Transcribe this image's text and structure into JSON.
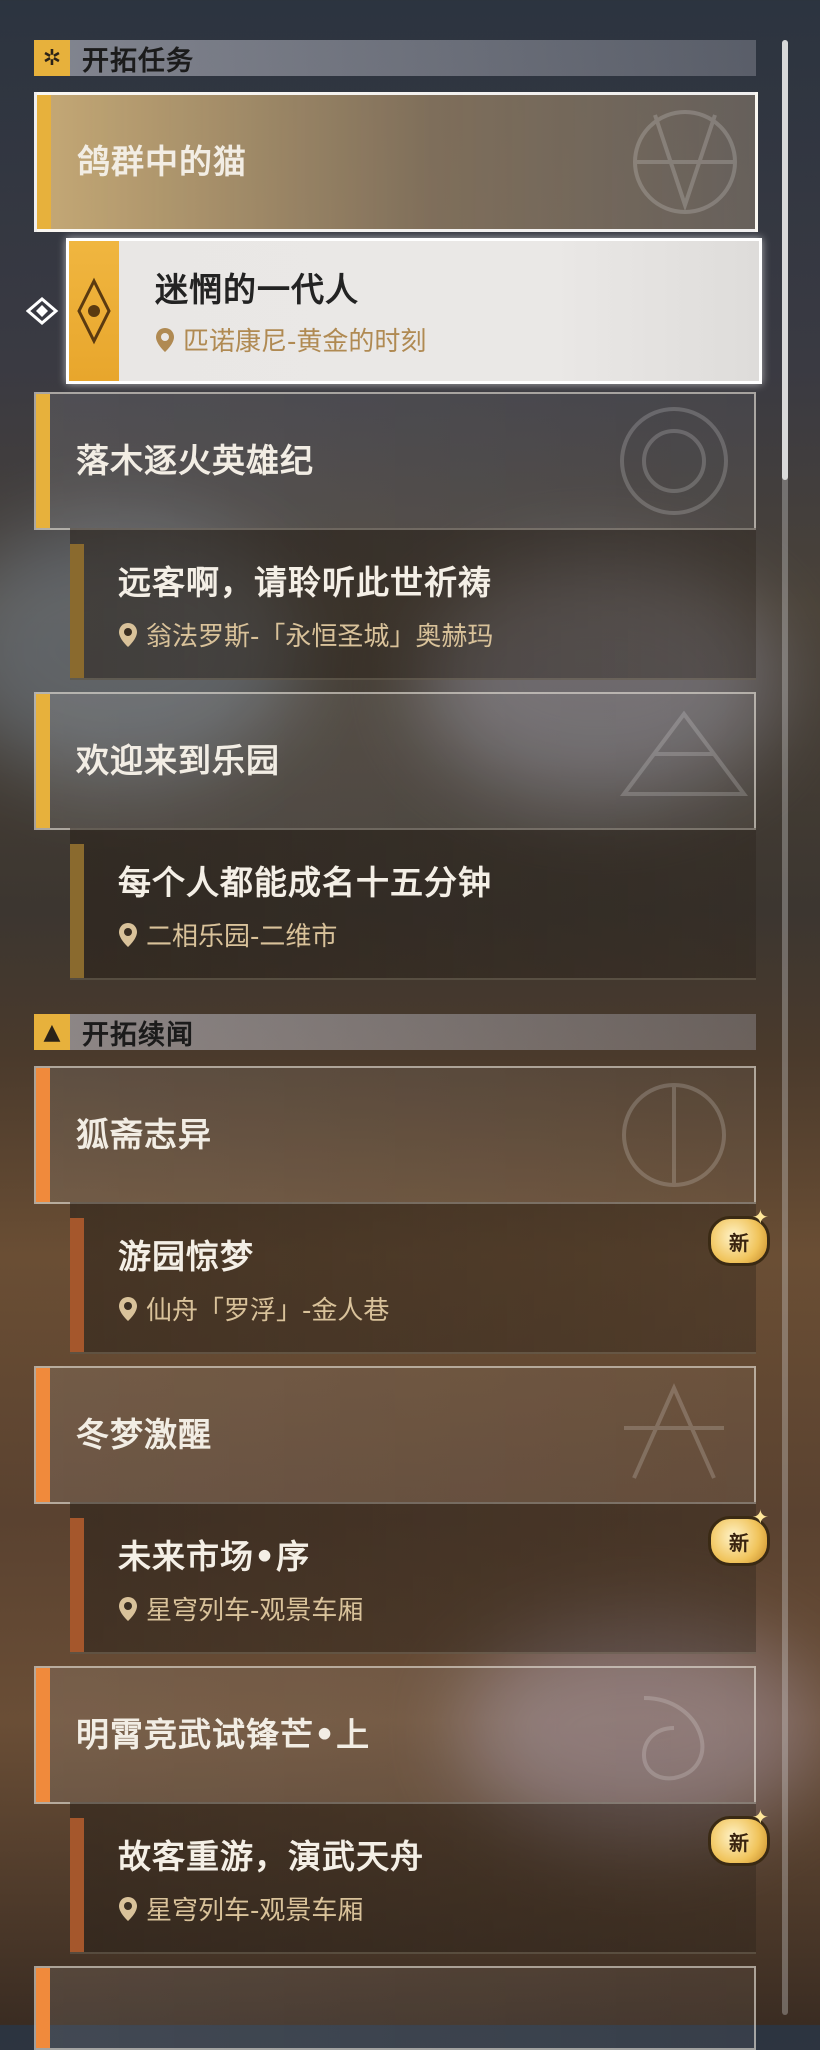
{
  "sections": [
    {
      "title": "开拓任务",
      "icon": "trailblaze-mission-icon",
      "items": [
        {
          "title": "鸽群中的猫",
          "sub": [
            {
              "name": "迷惘的一代人",
              "location": "匹诺康尼-黄金的时刻",
              "selected": true
            }
          ]
        },
        {
          "title": "落木逐火英雄纪",
          "sub": [
            {
              "name": "远客啊，请聆听此世祈祷",
              "location": "翁法罗斯-「永恒圣城」奥赫玛"
            }
          ]
        },
        {
          "title": "欢迎来到乐园",
          "sub": [
            {
              "name": "每个人都能成名十五分钟",
              "location": "二相乐园-二维市"
            }
          ]
        }
      ]
    },
    {
      "title": "开拓续闻",
      "icon": "trailblaze-continuance-icon",
      "items": [
        {
          "title": "狐斋志异",
          "sub": [
            {
              "name": "游园惊梦",
              "location": "仙舟「罗浮」-金人巷",
              "new": "新"
            }
          ]
        },
        {
          "title": "冬梦激醒",
          "sub": [
            {
              "name": "未来市场•序",
              "location": "星穹列车-观景车厢",
              "new": "新"
            }
          ]
        },
        {
          "title": "明霄竞武试锋芒•上",
          "sub": [
            {
              "name": "故客重游，演武天舟",
              "location": "星穹列车-观景车厢",
              "new": "新"
            }
          ]
        }
      ]
    }
  ],
  "colors": {
    "gold": "#e7b13c",
    "orange": "#f08a3c",
    "location": "#d9c29a"
  }
}
